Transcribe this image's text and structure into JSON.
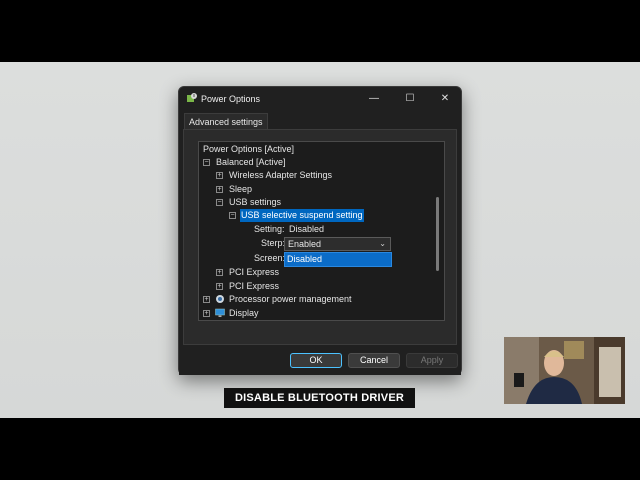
{
  "window": {
    "title": "Power Options",
    "tab_label": "Advanced settings",
    "controls": {
      "minimize": "—",
      "maximize": "☐",
      "close": "✕"
    }
  },
  "tree": {
    "items": [
      {
        "label": "Power Options [Active]"
      },
      {
        "label": "Balanced [Active]",
        "expander": "−"
      },
      {
        "label": "Wireless Adapter Settings",
        "expander": "+"
      },
      {
        "label": "Sleep",
        "expander": "+"
      },
      {
        "label": "USB settings",
        "expander": "−"
      },
      {
        "label": "USB selective suspend setting",
        "expander": "−"
      },
      {
        "label": "Setting:",
        "value": "Disabled"
      },
      {
        "label": "Sterp:",
        "value": "Enabled"
      },
      {
        "label": "Screen:",
        "value": "Disabled"
      },
      {
        "label": "PCI Express",
        "expander": "+"
      },
      {
        "label": "PCI Express",
        "expander": "+"
      },
      {
        "label": "Processor power management",
        "expander": "+"
      },
      {
        "label": "Display",
        "expander": "+"
      }
    ]
  },
  "buttons": {
    "ok": "OK",
    "cancel": "Cancel",
    "apply": "Apply"
  },
  "caption": "DISABLE BLUETOOTH DRIVER",
  "colors": {
    "accent": "#0067c0",
    "dialog_bg": "#202020",
    "selection_dropdown": "#0b6cc8"
  }
}
